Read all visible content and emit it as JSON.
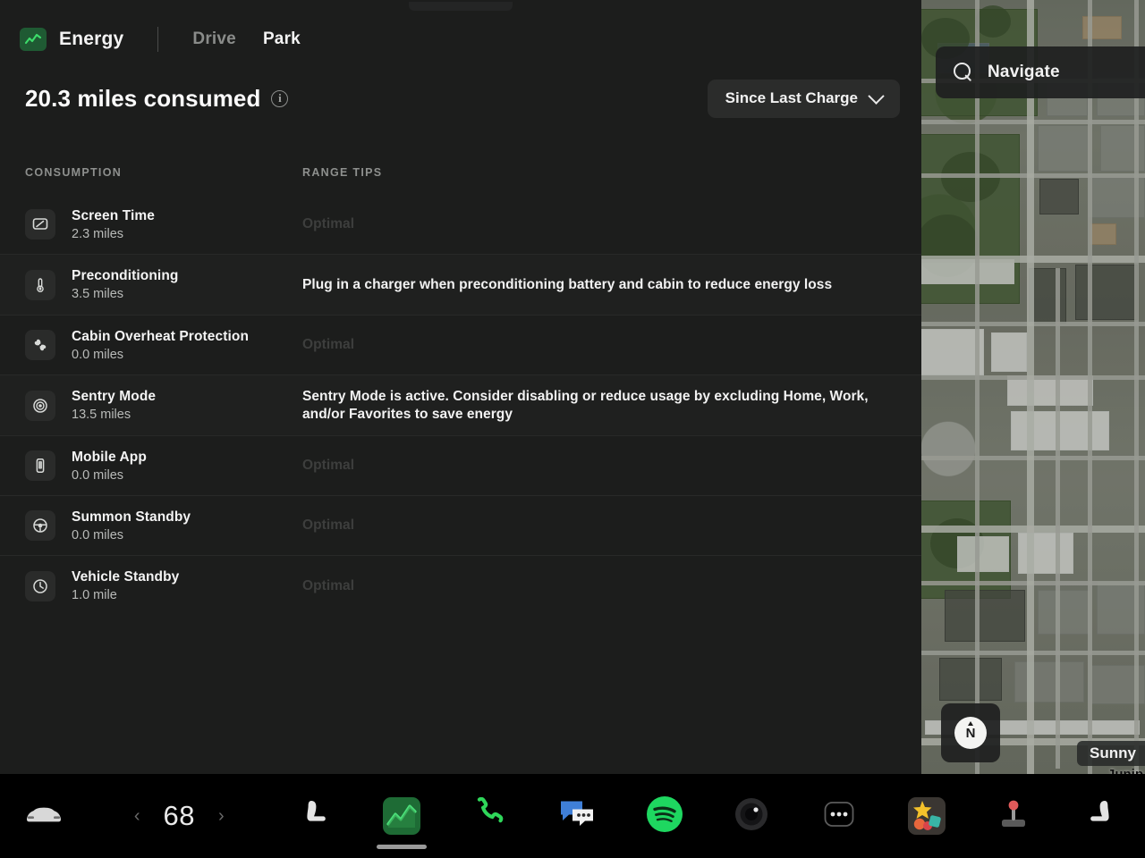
{
  "app": {
    "title": "Energy",
    "logo_icon": "energy-graph-icon"
  },
  "tabs": [
    {
      "label": "Drive",
      "active": false
    },
    {
      "label": "Park",
      "active": true
    }
  ],
  "summary": {
    "headline": "20.3 miles consumed",
    "info_icon": "info-icon",
    "info_glyph": "i"
  },
  "range_filter": {
    "label": "Since Last Charge",
    "chevron_icon": "chevron-down-icon"
  },
  "columns": {
    "consumption": "CONSUMPTION",
    "range_tips": "RANGE TIPS"
  },
  "rows": [
    {
      "icon": "screen-icon",
      "name": "Screen Time",
      "value": "2.3 miles",
      "tip": "Optimal",
      "tip_state": "optimal"
    },
    {
      "icon": "thermometer-icon",
      "name": "Preconditioning",
      "value": "3.5 miles",
      "tip": "Plug in a charger when preconditioning battery and cabin to reduce energy loss",
      "tip_state": "warn"
    },
    {
      "icon": "fan-icon",
      "name": "Cabin Overheat Protection",
      "value": "0.0 miles",
      "tip": "Optimal",
      "tip_state": "optimal"
    },
    {
      "icon": "sentry-camera-icon",
      "name": "Sentry Mode",
      "value": "13.5 miles",
      "tip": "Sentry Mode is active. Consider disabling or reduce usage by excluding Home, Work, and/or Favorites to save energy",
      "tip_state": "warn"
    },
    {
      "icon": "mobile-phone-icon",
      "name": "Mobile App",
      "value": "0.0 miles",
      "tip": "Optimal",
      "tip_state": "optimal"
    },
    {
      "icon": "steering-wheel-icon",
      "name": "Summon Standby",
      "value": "0.0 miles",
      "tip": "Optimal",
      "tip_state": "optimal"
    },
    {
      "icon": "clock-icon",
      "name": "Vehicle Standby",
      "value": "1.0 mile",
      "tip": "Optimal",
      "tip_state": "optimal"
    }
  ],
  "map": {
    "search_label": "Navigate",
    "search_icon": "search-icon",
    "compass_icon": "compass-north-icon",
    "compass_label": "N",
    "weather_label": "Sunny",
    "street_label": "Junip"
  },
  "dock": {
    "car_icon": "car-icon",
    "temperature": "68",
    "temp_down_icon": "chevron-left-icon",
    "temp_up_icon": "chevron-right-icon",
    "temp_down_glyph": "‹",
    "temp_up_glyph": "›",
    "seat_left_icon": "seat-heater-left-icon",
    "energy_icon": "energy-graph-icon",
    "phone_icon": "phone-icon",
    "messages_icon": "messages-icon",
    "spotify_icon": "spotify-icon",
    "camera_icon": "camera-icon",
    "more_icon": "more-dots-icon",
    "toybox_icon": "toybox-icon",
    "joystick_icon": "arcade-joystick-icon",
    "seat_right_icon": "seat-heater-right-icon"
  },
  "colors": {
    "panel_bg": "#1c1d1c",
    "row_alt_bg": "#1f201f",
    "accent_green": "#1f5a33",
    "text_primary": "#f4f4f4",
    "text_secondary": "#b9bbb9",
    "text_muted": "#3d3e3d",
    "spotify_green": "#1ed760",
    "messages_blue": "#3a7bd5"
  }
}
